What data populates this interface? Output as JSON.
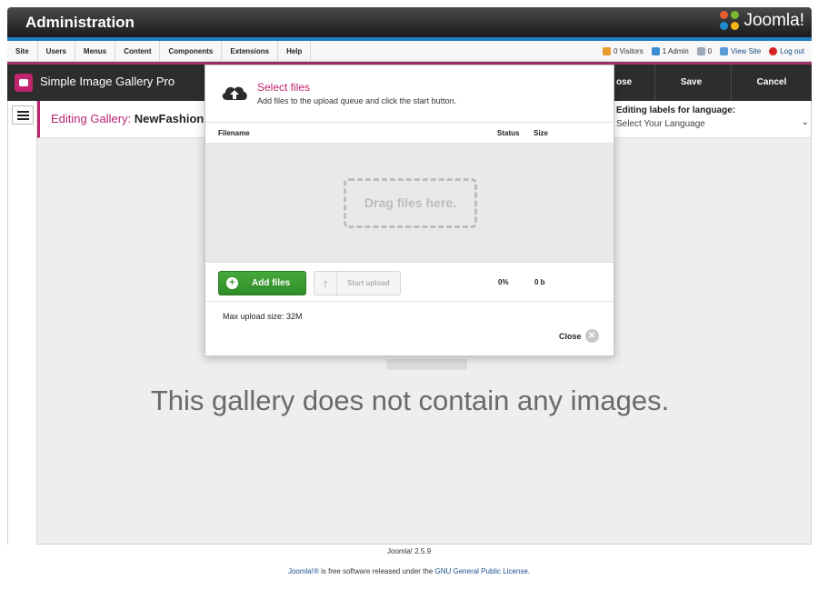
{
  "header": {
    "title": "Administration",
    "logo_text": "Joomla!"
  },
  "menubar": {
    "items": [
      "Site",
      "Users",
      "Menus",
      "Content",
      "Components",
      "Extensions",
      "Help"
    ],
    "status": {
      "visitors": "0 Visitors",
      "admins": "1 Admin",
      "messages": "0",
      "view_site": "View Site",
      "logout": "Log out"
    }
  },
  "toolbar": {
    "component_title": "Simple Image Gallery Pro",
    "close_label": "ose",
    "save_label": "Save",
    "cancel_label": "Cancel"
  },
  "editbar": {
    "label": "Editing Gallery:",
    "gallery_name": "NewFashion",
    "gallery_suffix": "(",
    "lang_label": "Editing labels for language:",
    "lang_value": "Select Your Language"
  },
  "main": {
    "empty_message": "This gallery does not contain any images."
  },
  "modal": {
    "title": "Select files",
    "subtitle": "Add files to the upload queue and click the start button.",
    "columns": {
      "filename": "Filename",
      "status": "Status",
      "size": "Size"
    },
    "dropzone_text": "Drag files here.",
    "add_files_label": "Add files",
    "start_upload_label": "Start upload",
    "progress_percent": "0%",
    "total_size": "0 b",
    "max_upload": "Max upload size: 32M",
    "close_label": "Close"
  },
  "footer": {
    "version": "Joomla! 2.5.9",
    "license_brand": "Joomla!®",
    "license_text": " is free software released under the ",
    "license_link": "GNU General Public License",
    "license_end": "."
  },
  "colors": {
    "accent": "#c0256d",
    "header_blue": "#1e7cc0",
    "add_green": "#3a9a31",
    "toolbar": "#2d2d2d"
  }
}
